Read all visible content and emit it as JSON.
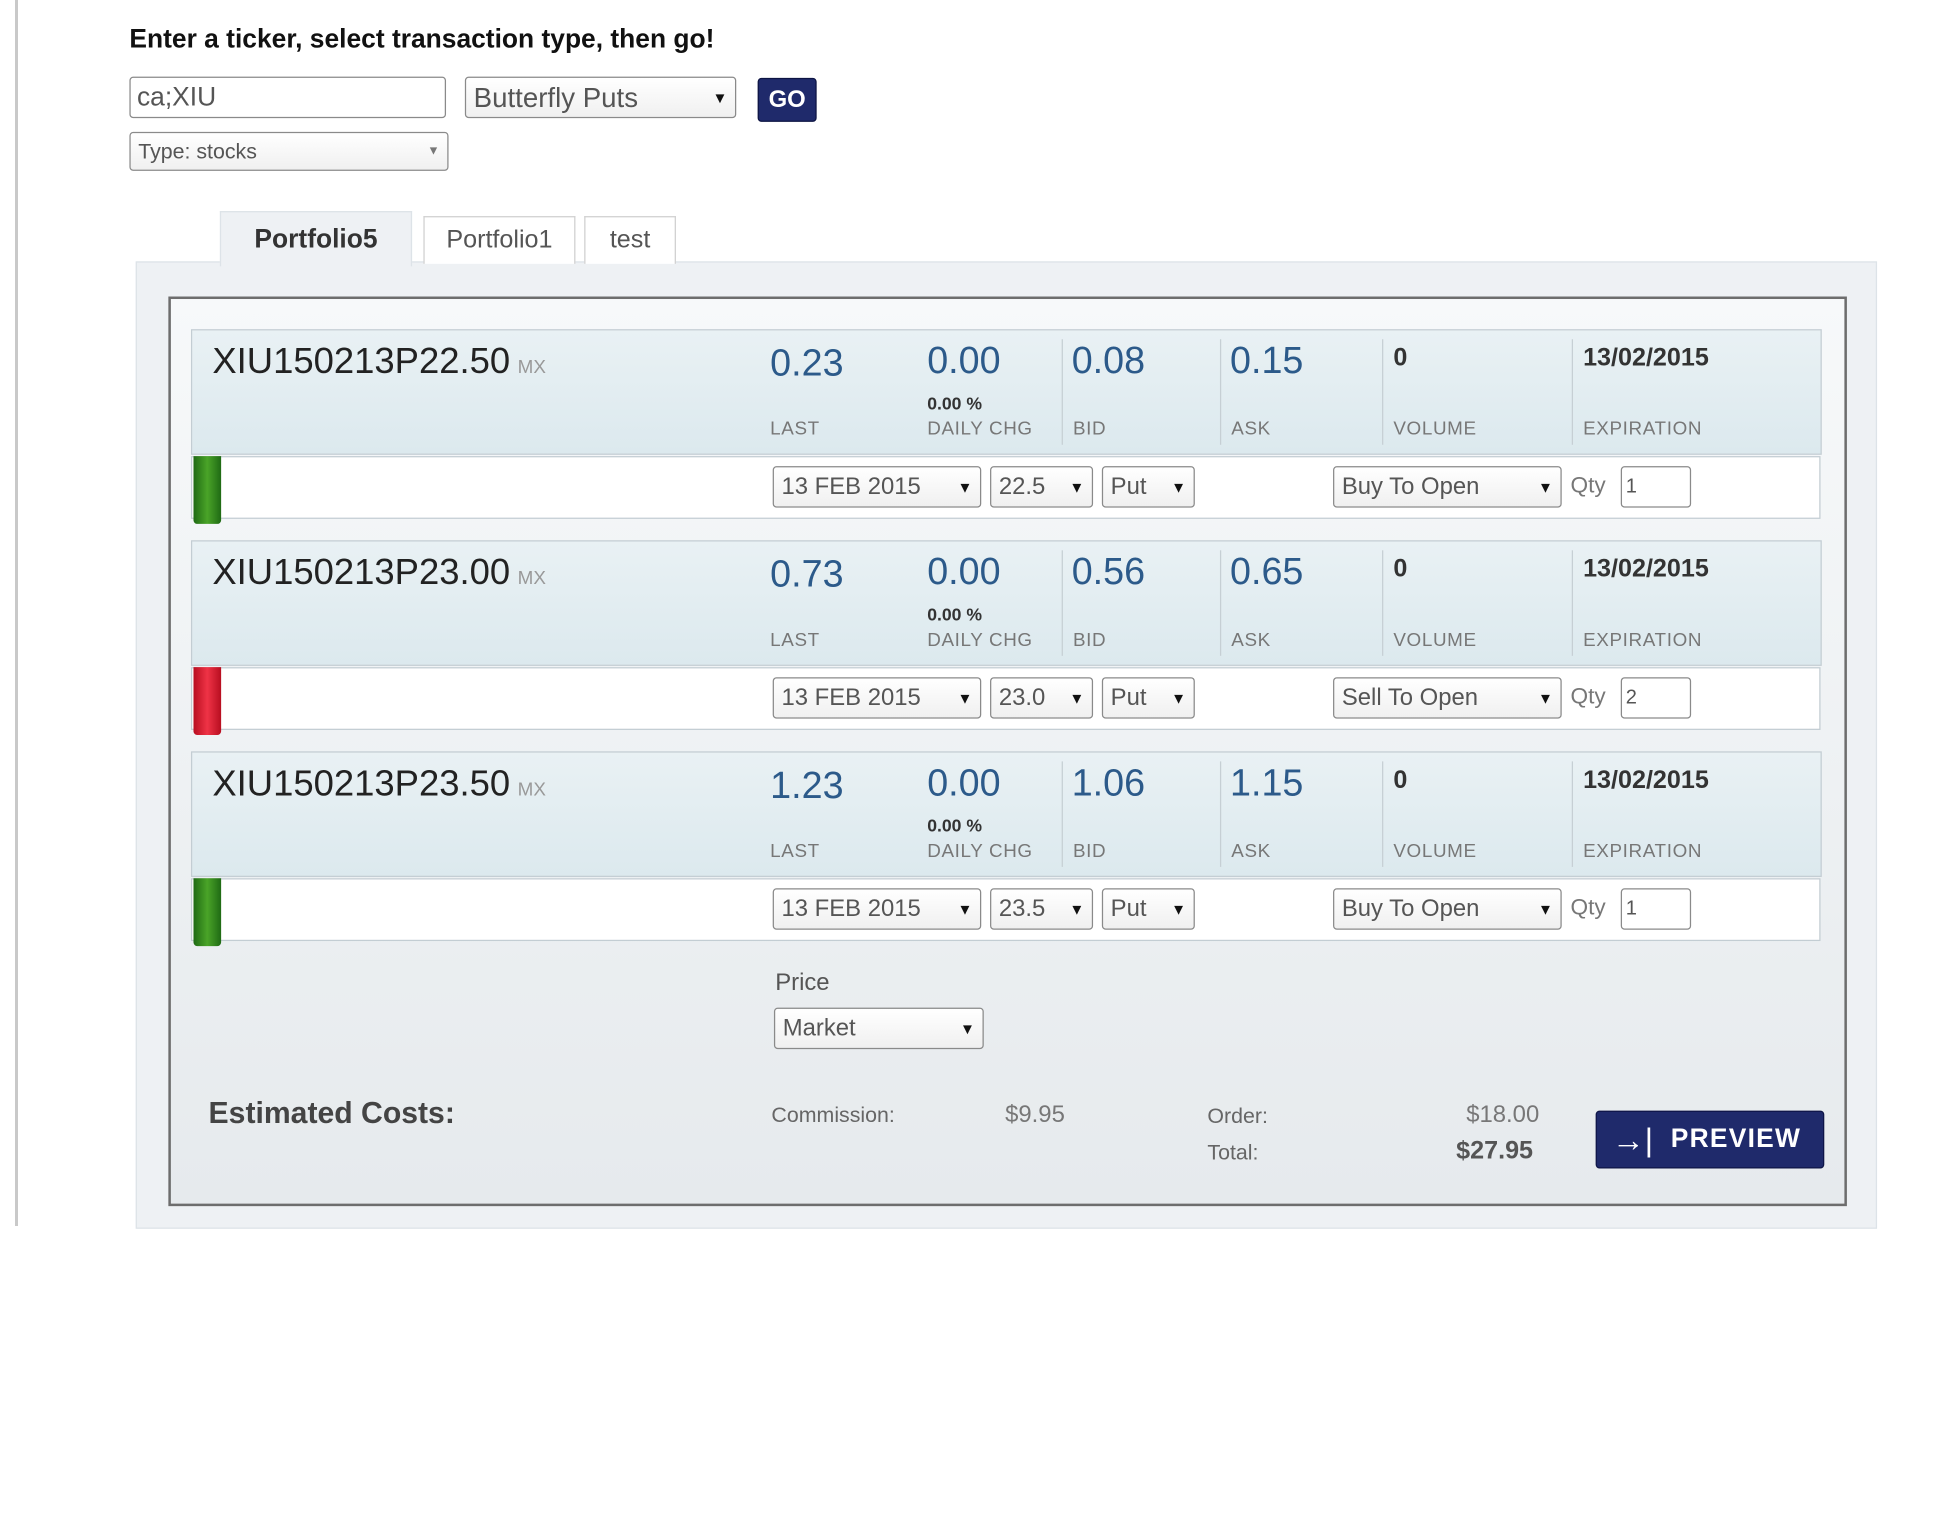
{
  "prompt": "Enter a ticker, select transaction type, then go!",
  "ticker": {
    "value": "ca;XIU"
  },
  "transaction_type": {
    "selected": "Butterfly Puts"
  },
  "security_type": {
    "selected": "Type: stocks"
  },
  "go_label": "GO",
  "tabs": [
    {
      "label": "Portfolio5",
      "active": true
    },
    {
      "label": "Portfolio1",
      "active": false
    },
    {
      "label": "test",
      "active": false
    }
  ],
  "captions": {
    "last": "LAST",
    "daily_chg": "DAILY CHG",
    "bid": "BID",
    "ask": "ASK",
    "volume": "VOLUME",
    "expiration": "EXPIRATION"
  },
  "legs": [
    {
      "symbol": "XIU150213P22.50",
      "exchange": "MX",
      "last": "0.23",
      "daily_chg": "0.00",
      "daily_chg_pct": "0.00 %",
      "bid": "0.08",
      "ask": "0.15",
      "volume": "0",
      "expiration": "13/02/2015",
      "exp_select": "13 FEB 2015",
      "strike_select": "22.5",
      "right_select": "Put",
      "action_select": "Buy To Open",
      "qty_label": "Qty",
      "qty": "1",
      "marker_color": "#3f9a24"
    },
    {
      "symbol": "XIU150213P23.00",
      "exchange": "MX",
      "last": "0.73",
      "daily_chg": "0.00",
      "daily_chg_pct": "0.00 %",
      "bid": "0.56",
      "ask": "0.65",
      "volume": "0",
      "expiration": "13/02/2015",
      "exp_select": "13 FEB 2015",
      "strike_select": "23.0",
      "right_select": "Put",
      "action_select": "Sell To Open",
      "qty_label": "Qty",
      "qty": "2",
      "marker_color": "#e42a3b"
    },
    {
      "symbol": "XIU150213P23.50",
      "exchange": "MX",
      "last": "1.23",
      "daily_chg": "0.00",
      "daily_chg_pct": "0.00 %",
      "bid": "1.06",
      "ask": "1.15",
      "volume": "0",
      "expiration": "13/02/2015",
      "exp_select": "13 FEB 2015",
      "strike_select": "23.5",
      "right_select": "Put",
      "action_select": "Buy To Open",
      "qty_label": "Qty",
      "qty": "1",
      "marker_color": "#3f9a24"
    }
  ],
  "price": {
    "label": "Price",
    "selected": "Market"
  },
  "estimated": {
    "title": "Estimated Costs:",
    "commission_label": "Commission:",
    "commission": "$9.95",
    "order_label": "Order:",
    "order": "$18.00",
    "total_label": "Total:",
    "total": "$27.95"
  },
  "preview_label": "PREVIEW",
  "colors": {
    "button_navy": "#1f2a6b",
    "value_blue": "#2c5a8a",
    "buy_green": "#3f9a24",
    "sell_red": "#e42a3b"
  }
}
